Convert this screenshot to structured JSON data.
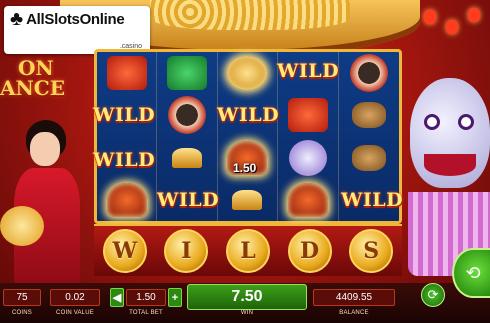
{
  "logo": {
    "brand": "AllSlotsOnline",
    "sub": ".casino"
  },
  "title": {
    "line1": "ON",
    "line2": "ANCE"
  },
  "reels": {
    "wild_label": "WILD",
    "win_amount": "1.50"
  },
  "coin_row": [
    "W",
    "I",
    "L",
    "D",
    "S"
  ],
  "controls": {
    "coins_value": "75",
    "coins_label": "COINS",
    "coin_value_value": "0.02",
    "coin_value_label": "COIN VALUE",
    "total_bet_value": "1.50",
    "total_bet_label": "TOTAL BET",
    "decrease_label": "◀",
    "increase_label": "+",
    "win_value": "7.50",
    "win_label": "WIN",
    "balance_value": "4409.55",
    "balance_label": "BALANCE",
    "autoplay_icon": "⟳",
    "spin_icon": "⟲"
  },
  "colors": {
    "reel_bg": "#0e3c86",
    "frame_gold": "#f0b83a",
    "win_green": "#3da01a"
  }
}
